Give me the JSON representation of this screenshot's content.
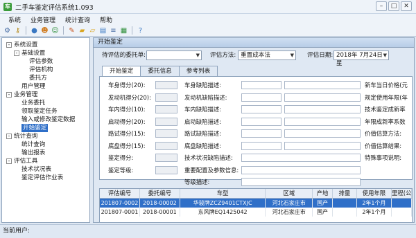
{
  "window": {
    "title": "二手车鉴定评估系统1.093",
    "app_icon": "车"
  },
  "menu": {
    "items": [
      "系统",
      "业务管理",
      "统计查询",
      "帮助"
    ]
  },
  "toolbar": {
    "icons": [
      "gear-icon",
      "key-icon",
      "user-icon",
      "users-icon",
      "user-edit-icon",
      "pencil-icon",
      "folder-icon",
      "folder-open-icon",
      "chart-icon",
      "database-icon",
      "table-icon",
      "help-icon"
    ]
  },
  "sidebar": {
    "items": [
      {
        "label": "系统设置",
        "indent": 0,
        "expander": "-"
      },
      {
        "label": "基础设置",
        "indent": 1,
        "expander": "-"
      },
      {
        "label": "评估参数",
        "indent": 2
      },
      {
        "label": "评估机构",
        "indent": 2
      },
      {
        "label": "委托方",
        "indent": 2
      },
      {
        "label": "用户管理",
        "indent": 1
      },
      {
        "label": "业务管理",
        "indent": 0,
        "expander": "-"
      },
      {
        "label": "业务委托",
        "indent": 1
      },
      {
        "label": "领取鉴定任务",
        "indent": 1
      },
      {
        "label": "输入或修改鉴定数据",
        "indent": 1
      },
      {
        "label": "开始鉴定",
        "indent": 1,
        "selected": true
      },
      {
        "label": "统计查询",
        "indent": 0,
        "expander": "-"
      },
      {
        "label": "统计查询",
        "indent": 1
      },
      {
        "label": "输出报表",
        "indent": 1
      },
      {
        "label": "评估工具",
        "indent": 0,
        "expander": "-"
      },
      {
        "label": "技术状况表",
        "indent": 1
      },
      {
        "label": "鉴定评估作业表",
        "indent": 1
      }
    ]
  },
  "main": {
    "header": "开始鉴定",
    "filters": {
      "order_label": "待评估的委托单:",
      "order_value": "",
      "method_label": "评估方法:",
      "method_value": "重置成本法",
      "date_label": "评估日期:",
      "date_value": "2018年 7月24日 星"
    },
    "tabs": [
      "开始鉴定",
      "委托信息",
      "参考列表"
    ],
    "left_fields": [
      "车身得分(20):",
      "发动机得分(20):",
      "车内得分(10):",
      "启动得分(20):",
      "路试得分(15):",
      "底盘得分(15):",
      "鉴定得分:",
      "鉴定等级:"
    ],
    "mid_fields": [
      "车身缺陷描述:",
      "发动机缺陷描述:",
      "车内缺陷描述:",
      "启动缺陷描述:",
      "路试缺陷描述:",
      "底盘缺陷描述:",
      "技术状况缺陷描述:",
      "重要配置及参数信息:",
      "等级描述:"
    ],
    "right_fields": [
      "新车当日价格(元",
      "规定使用年限(年",
      "技术鉴定成新率",
      "年限成新率系数",
      "价值估算方法:",
      "价值估算结果:",
      "特殊事项说明:"
    ]
  },
  "grid": {
    "columns": [
      "评估编号",
      "委托编号",
      "车型",
      "区域",
      "产地",
      "排量",
      "使用年限",
      "里程(公"
    ],
    "rows": [
      [
        "201807-0002",
        "2018-00002",
        "华骏牌ZCZ9401CTXJC",
        "河北石家庄市",
        "国产",
        "",
        "2年1个月",
        ""
      ],
      [
        "201807-0001",
        "2018-00001",
        "东风牌EQ1425042",
        "河北石家庄市",
        "国产",
        "",
        "2年1个月",
        ""
      ]
    ]
  },
  "status": {
    "text": "当前用户:"
  }
}
